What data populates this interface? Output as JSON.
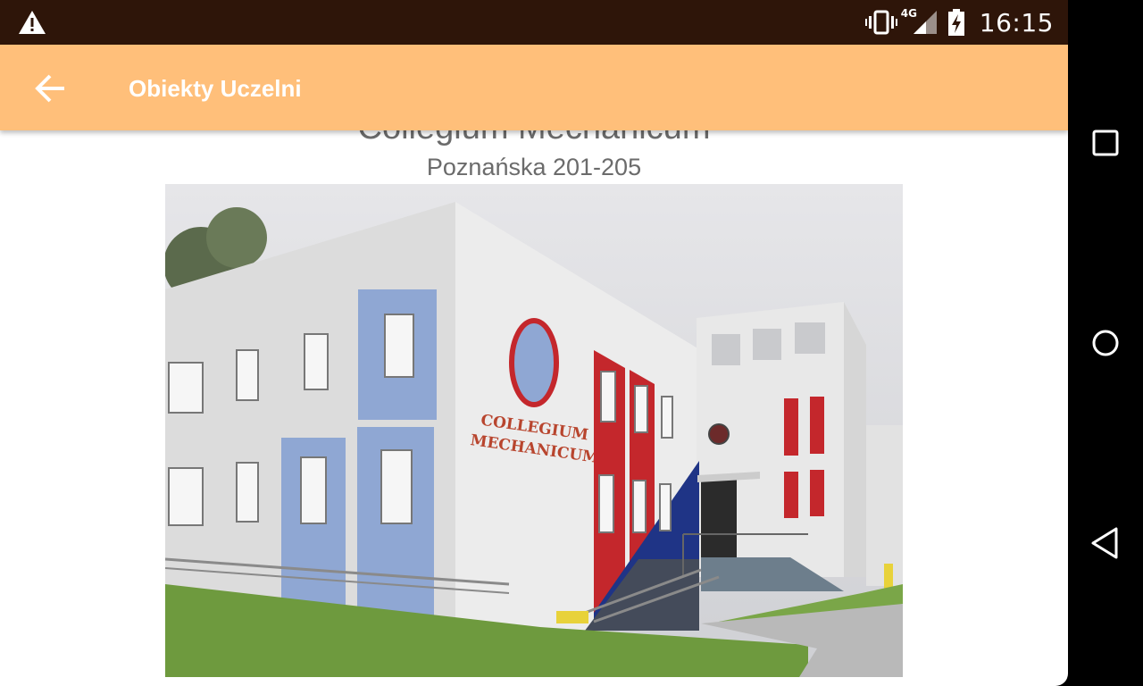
{
  "status_bar": {
    "time": "16:15",
    "network": "4G",
    "icons": [
      "warning-icon",
      "vibrate-icon",
      "signal-icon",
      "battery-charging-icon"
    ]
  },
  "toolbar": {
    "title": "Obiekty Uczelni",
    "back_icon": "arrow-left-icon"
  },
  "building": {
    "name": "Collegium Mechanicum",
    "address": "Poznańska 201-205",
    "photo_sign": [
      "COLLEGIUM",
      "MECHANICUM"
    ]
  },
  "nav_bar": {
    "icons": [
      "recent-apps-icon",
      "home-icon",
      "back-icon"
    ]
  },
  "colors": {
    "status_bar": "#2e1509",
    "toolbar": "#ffbf7a",
    "text_gray": "#6b6b6b"
  }
}
